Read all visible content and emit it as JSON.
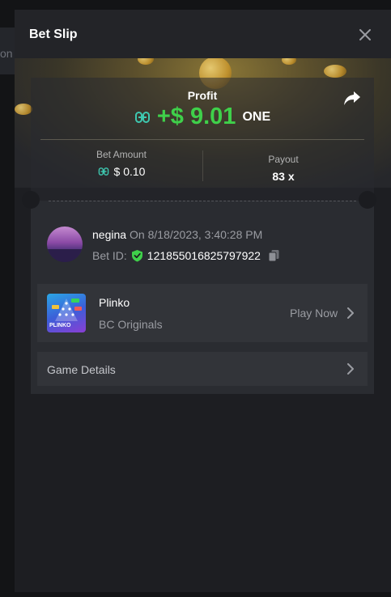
{
  "background": {
    "partial_text": "on"
  },
  "modal": {
    "title": "Bet Slip"
  },
  "profit": {
    "label": "Profit",
    "value": "+$ 9.01",
    "currency": "ONE",
    "color": "#3fd04a"
  },
  "bet_amount": {
    "label": "Bet Amount",
    "value": "$ 0.10"
  },
  "payout": {
    "label": "Payout",
    "value": "83 x"
  },
  "user": {
    "name": "negina",
    "date": "On 8/18/2023, 3:40:28 PM",
    "bet_id_label": "Bet ID:",
    "bet_id": "121855016825797922"
  },
  "game": {
    "name": "Plinko",
    "provider": "BC Originals",
    "play_label": "Play Now",
    "thumb_label": "PLINKO"
  },
  "details": {
    "label": "Game Details"
  },
  "icons": {
    "close": "close-icon",
    "share": "share-icon",
    "token": "one-token-icon",
    "verified": "verified-shield-icon",
    "copy": "copy-icon",
    "chevron": "chevron-right-icon"
  },
  "colors": {
    "accent": "#3fd04a",
    "token": "#3ec8b0"
  }
}
